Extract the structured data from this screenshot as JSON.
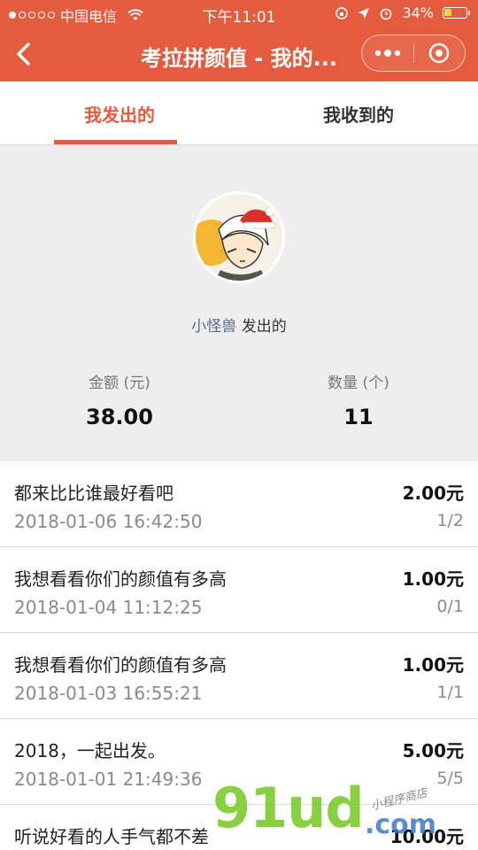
{
  "status_bar": {
    "carrier": "中国电信",
    "time": "下午11:01",
    "battery": "34%"
  },
  "nav": {
    "title": "考拉拼颜值 - 我的...",
    "more_icon": "more-dots-icon",
    "close_icon": "target-circle-icon"
  },
  "tabs": [
    {
      "label": "我发出的",
      "active": true
    },
    {
      "label": "我收到的",
      "active": false
    }
  ],
  "summary": {
    "nickname": "小怪兽",
    "sent_suffix": "发出的",
    "amount_label": "金额 (元)",
    "amount_value": "38.00",
    "count_label": "数量 (个)",
    "count_value": "11"
  },
  "list": [
    {
      "title": "都来比比谁最好看吧",
      "date": "2018-01-06 16:42:50",
      "amount": "2.00元",
      "count": "1/2"
    },
    {
      "title": "我想看看你们的颜值有多高",
      "date": "2018-01-04 11:12:25",
      "amount": "1.00元",
      "count": "0/1"
    },
    {
      "title": "我想看看你们的颜值有多高",
      "date": "2018-01-03 16:55:21",
      "amount": "1.00元",
      "count": "1/1"
    },
    {
      "title": "2018，一起出发。",
      "date": "2018-01-01 21:49:36",
      "amount": "5.00元",
      "count": "5/5"
    },
    {
      "title": "听说好看的人手气都不差",
      "date": "",
      "amount": "10.00元",
      "count": ""
    }
  ],
  "watermark": {
    "main": "91ud",
    "tld": ".com",
    "small": "小程序商店"
  },
  "colors": {
    "brand": "#e45b3d",
    "summary_bg": "#eeeeee",
    "nickname": "#5a6b8c"
  }
}
